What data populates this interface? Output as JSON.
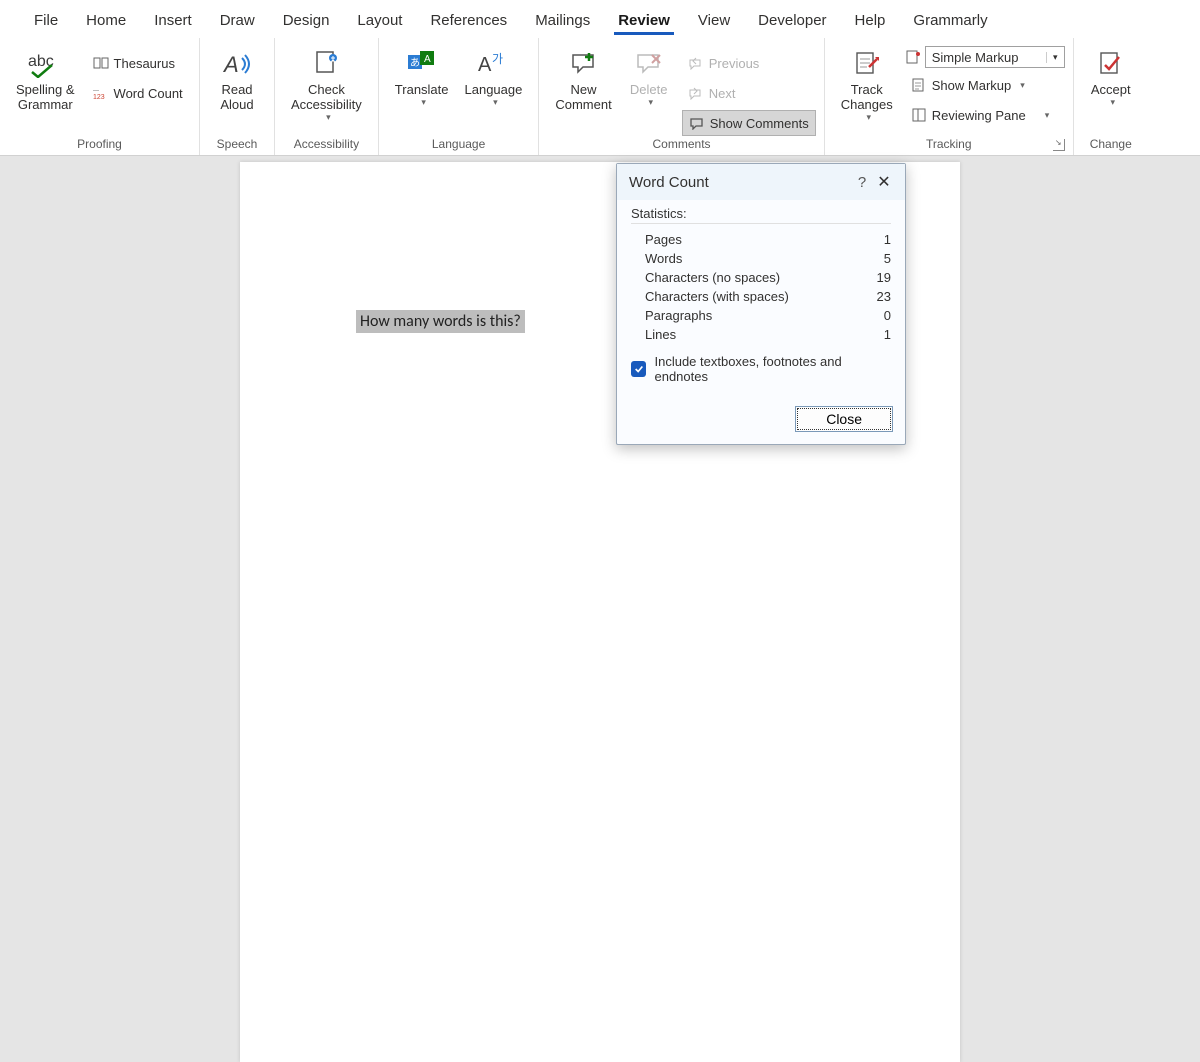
{
  "tabs": [
    "File",
    "Home",
    "Insert",
    "Draw",
    "Design",
    "Layout",
    "References",
    "Mailings",
    "Review",
    "View",
    "Developer",
    "Help",
    "Grammarly"
  ],
  "active_tab_index": 8,
  "ribbon": {
    "proofing": {
      "label": "Proofing",
      "spelling": "Spelling &\nGrammar",
      "thesaurus": "Thesaurus",
      "wordcount": "Word Count"
    },
    "speech": {
      "label": "Speech",
      "read_aloud": "Read\nAloud"
    },
    "accessibility": {
      "label": "Accessibility",
      "check": "Check\nAccessibility"
    },
    "language": {
      "label": "Language",
      "translate": "Translate",
      "language": "Language"
    },
    "comments": {
      "label": "Comments",
      "new": "New\nComment",
      "delete": "Delete",
      "previous": "Previous",
      "next": "Next",
      "show": "Show Comments"
    },
    "tracking": {
      "label": "Tracking",
      "track": "Track\nChanges",
      "markup_mode": "Simple Markup",
      "show_markup": "Show Markup",
      "reviewing_pane": "Reviewing Pane"
    },
    "changes": {
      "label": "Change",
      "accept": "Accept"
    }
  },
  "document": {
    "selected_text": "How many words is this?"
  },
  "dialog": {
    "title": "Word Count",
    "stats_label": "Statistics:",
    "rows": [
      {
        "k": "Pages",
        "v": "1"
      },
      {
        "k": "Words",
        "v": "5"
      },
      {
        "k": "Characters (no spaces)",
        "v": "19"
      },
      {
        "k": "Characters (with spaces)",
        "v": "23"
      },
      {
        "k": "Paragraphs",
        "v": "0"
      },
      {
        "k": "Lines",
        "v": "1"
      }
    ],
    "checkbox_label": "Include textboxes, footnotes and endnotes",
    "checkbox_checked": true,
    "close": "Close"
  }
}
